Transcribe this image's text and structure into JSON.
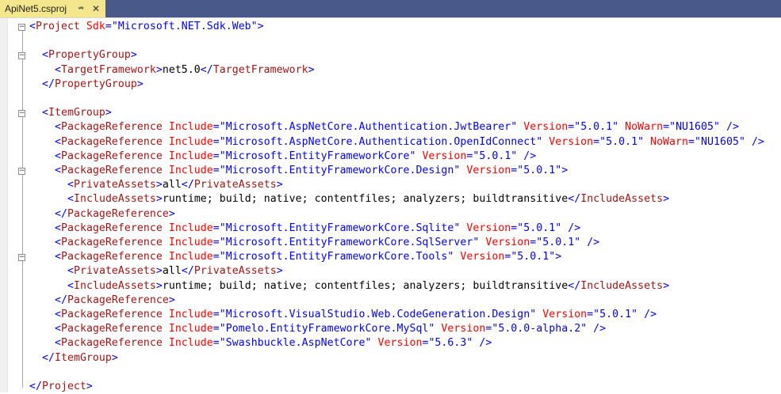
{
  "tab": {
    "title": "ApiNet5.csproj",
    "pin_icon": "pin-icon",
    "close_icon": "close-icon",
    "pin_glyph": "⇏",
    "close_glyph": "✕"
  },
  "colors": {
    "tabstrip_bg": "#495a8a",
    "tab_bg": "#f4e68c",
    "tag": "#a31515",
    "punctuation": "#0000ff",
    "attribute": "#ff0000",
    "value": "#0000ff",
    "text": "#000000"
  },
  "code_lines": [
    {
      "indent": 0,
      "tokens": [
        {
          "t": "punc",
          "v": "<"
        },
        {
          "t": "tag",
          "v": "Project"
        },
        {
          "t": "attr",
          "v": " Sdk"
        },
        {
          "t": "punc",
          "v": "="
        },
        {
          "t": "val",
          "v": "\"Microsoft.NET.Sdk.Web\""
        },
        {
          "t": "punc",
          "v": ">"
        }
      ]
    },
    {
      "indent": 0,
      "tokens": []
    },
    {
      "indent": 2,
      "tokens": [
        {
          "t": "punc",
          "v": "<"
        },
        {
          "t": "tag",
          "v": "PropertyGroup"
        },
        {
          "t": "punc",
          "v": ">"
        }
      ]
    },
    {
      "indent": 4,
      "tokens": [
        {
          "t": "punc",
          "v": "<"
        },
        {
          "t": "tag",
          "v": "TargetFramework"
        },
        {
          "t": "punc",
          "v": ">"
        },
        {
          "t": "txt",
          "v": "net5.0"
        },
        {
          "t": "punc",
          "v": "</"
        },
        {
          "t": "tag",
          "v": "TargetFramework"
        },
        {
          "t": "punc",
          "v": ">"
        }
      ]
    },
    {
      "indent": 2,
      "tokens": [
        {
          "t": "punc",
          "v": "</"
        },
        {
          "t": "tag",
          "v": "PropertyGroup"
        },
        {
          "t": "punc",
          "v": ">"
        }
      ]
    },
    {
      "indent": 0,
      "tokens": []
    },
    {
      "indent": 2,
      "tokens": [
        {
          "t": "punc",
          "v": "<"
        },
        {
          "t": "tag",
          "v": "ItemGroup"
        },
        {
          "t": "punc",
          "v": ">"
        }
      ]
    },
    {
      "indent": 4,
      "tokens": [
        {
          "t": "punc",
          "v": "<"
        },
        {
          "t": "tag",
          "v": "PackageReference"
        },
        {
          "t": "attr",
          "v": " Include"
        },
        {
          "t": "punc",
          "v": "="
        },
        {
          "t": "val",
          "v": "\"Microsoft.AspNetCore.Authentication.JwtBearer\""
        },
        {
          "t": "attr",
          "v": " Version"
        },
        {
          "t": "punc",
          "v": "="
        },
        {
          "t": "val",
          "v": "\"5.0.1\""
        },
        {
          "t": "attr",
          "v": " NoWarn"
        },
        {
          "t": "punc",
          "v": "="
        },
        {
          "t": "val",
          "v": "\"NU1605\""
        },
        {
          "t": "punc",
          "v": " />"
        }
      ]
    },
    {
      "indent": 4,
      "tokens": [
        {
          "t": "punc",
          "v": "<"
        },
        {
          "t": "tag",
          "v": "PackageReference"
        },
        {
          "t": "attr",
          "v": " Include"
        },
        {
          "t": "punc",
          "v": "="
        },
        {
          "t": "val",
          "v": "\"Microsoft.AspNetCore.Authentication.OpenIdConnect\""
        },
        {
          "t": "attr",
          "v": " Version"
        },
        {
          "t": "punc",
          "v": "="
        },
        {
          "t": "val",
          "v": "\"5.0.1\""
        },
        {
          "t": "attr",
          "v": " NoWarn"
        },
        {
          "t": "punc",
          "v": "="
        },
        {
          "t": "val",
          "v": "\"NU1605\""
        },
        {
          "t": "punc",
          "v": " />"
        }
      ]
    },
    {
      "indent": 4,
      "tokens": [
        {
          "t": "punc",
          "v": "<"
        },
        {
          "t": "tag",
          "v": "PackageReference"
        },
        {
          "t": "attr",
          "v": " Include"
        },
        {
          "t": "punc",
          "v": "="
        },
        {
          "t": "val",
          "v": "\"Microsoft.EntityFrameworkCore\""
        },
        {
          "t": "attr",
          "v": " Version"
        },
        {
          "t": "punc",
          "v": "="
        },
        {
          "t": "val",
          "v": "\"5.0.1\""
        },
        {
          "t": "punc",
          "v": " />"
        }
      ]
    },
    {
      "indent": 4,
      "tokens": [
        {
          "t": "punc",
          "v": "<"
        },
        {
          "t": "tag",
          "v": "PackageReference"
        },
        {
          "t": "attr",
          "v": " Include"
        },
        {
          "t": "punc",
          "v": "="
        },
        {
          "t": "val",
          "v": "\"Microsoft.EntityFrameworkCore.Design\""
        },
        {
          "t": "attr",
          "v": " Version"
        },
        {
          "t": "punc",
          "v": "="
        },
        {
          "t": "val",
          "v": "\"5.0.1\""
        },
        {
          "t": "punc",
          "v": ">"
        }
      ]
    },
    {
      "indent": 6,
      "tokens": [
        {
          "t": "punc",
          "v": "<"
        },
        {
          "t": "tag",
          "v": "PrivateAssets"
        },
        {
          "t": "punc",
          "v": ">"
        },
        {
          "t": "txt",
          "v": "all"
        },
        {
          "t": "punc",
          "v": "</"
        },
        {
          "t": "tag",
          "v": "PrivateAssets"
        },
        {
          "t": "punc",
          "v": ">"
        }
      ]
    },
    {
      "indent": 6,
      "tokens": [
        {
          "t": "punc",
          "v": "<"
        },
        {
          "t": "tag",
          "v": "IncludeAssets"
        },
        {
          "t": "punc",
          "v": ">"
        },
        {
          "t": "txt",
          "v": "runtime; build; native; contentfiles; analyzers; buildtransitive"
        },
        {
          "t": "punc",
          "v": "</"
        },
        {
          "t": "tag",
          "v": "IncludeAssets"
        },
        {
          "t": "punc",
          "v": ">"
        }
      ]
    },
    {
      "indent": 4,
      "tokens": [
        {
          "t": "punc",
          "v": "</"
        },
        {
          "t": "tag",
          "v": "PackageReference"
        },
        {
          "t": "punc",
          "v": ">"
        }
      ]
    },
    {
      "indent": 4,
      "tokens": [
        {
          "t": "punc",
          "v": "<"
        },
        {
          "t": "tag",
          "v": "PackageReference"
        },
        {
          "t": "attr",
          "v": " Include"
        },
        {
          "t": "punc",
          "v": "="
        },
        {
          "t": "val",
          "v": "\"Microsoft.EntityFrameworkCore.Sqlite\""
        },
        {
          "t": "attr",
          "v": " Version"
        },
        {
          "t": "punc",
          "v": "="
        },
        {
          "t": "val",
          "v": "\"5.0.1\""
        },
        {
          "t": "punc",
          "v": " />"
        }
      ]
    },
    {
      "indent": 4,
      "tokens": [
        {
          "t": "punc",
          "v": "<"
        },
        {
          "t": "tag",
          "v": "PackageReference"
        },
        {
          "t": "attr",
          "v": " Include"
        },
        {
          "t": "punc",
          "v": "="
        },
        {
          "t": "val",
          "v": "\"Microsoft.EntityFrameworkCore.SqlServer\""
        },
        {
          "t": "attr",
          "v": " Version"
        },
        {
          "t": "punc",
          "v": "="
        },
        {
          "t": "val",
          "v": "\"5.0.1\""
        },
        {
          "t": "punc",
          "v": " />"
        }
      ]
    },
    {
      "indent": 4,
      "tokens": [
        {
          "t": "punc",
          "v": "<"
        },
        {
          "t": "tag",
          "v": "PackageReference"
        },
        {
          "t": "attr",
          "v": " Include"
        },
        {
          "t": "punc",
          "v": "="
        },
        {
          "t": "val",
          "v": "\"Microsoft.EntityFrameworkCore.Tools\""
        },
        {
          "t": "attr",
          "v": " Version"
        },
        {
          "t": "punc",
          "v": "="
        },
        {
          "t": "val",
          "v": "\"5.0.1\""
        },
        {
          "t": "punc",
          "v": ">"
        }
      ]
    },
    {
      "indent": 6,
      "tokens": [
        {
          "t": "punc",
          "v": "<"
        },
        {
          "t": "tag",
          "v": "PrivateAssets"
        },
        {
          "t": "punc",
          "v": ">"
        },
        {
          "t": "txt",
          "v": "all"
        },
        {
          "t": "punc",
          "v": "</"
        },
        {
          "t": "tag",
          "v": "PrivateAssets"
        },
        {
          "t": "punc",
          "v": ">"
        }
      ]
    },
    {
      "indent": 6,
      "tokens": [
        {
          "t": "punc",
          "v": "<"
        },
        {
          "t": "tag",
          "v": "IncludeAssets"
        },
        {
          "t": "punc",
          "v": ">"
        },
        {
          "t": "txt",
          "v": "runtime; build; native; contentfiles; analyzers; buildtransitive"
        },
        {
          "t": "punc",
          "v": "</"
        },
        {
          "t": "tag",
          "v": "IncludeAssets"
        },
        {
          "t": "punc",
          "v": ">"
        }
      ]
    },
    {
      "indent": 4,
      "tokens": [
        {
          "t": "punc",
          "v": "</"
        },
        {
          "t": "tag",
          "v": "PackageReference"
        },
        {
          "t": "punc",
          "v": ">"
        }
      ]
    },
    {
      "indent": 4,
      "tokens": [
        {
          "t": "punc",
          "v": "<"
        },
        {
          "t": "tag",
          "v": "PackageReference"
        },
        {
          "t": "attr",
          "v": " Include"
        },
        {
          "t": "punc",
          "v": "="
        },
        {
          "t": "val",
          "v": "\"Microsoft.VisualStudio.Web.CodeGeneration.Design\""
        },
        {
          "t": "attr",
          "v": " Version"
        },
        {
          "t": "punc",
          "v": "="
        },
        {
          "t": "val",
          "v": "\"5.0.1\""
        },
        {
          "t": "punc",
          "v": " />"
        }
      ]
    },
    {
      "indent": 4,
      "tokens": [
        {
          "t": "punc",
          "v": "<"
        },
        {
          "t": "tag",
          "v": "PackageReference"
        },
        {
          "t": "attr",
          "v": " Include"
        },
        {
          "t": "punc",
          "v": "="
        },
        {
          "t": "val",
          "v": "\"Pomelo.EntityFrameworkCore.MySql\""
        },
        {
          "t": "attr",
          "v": " Version"
        },
        {
          "t": "punc",
          "v": "="
        },
        {
          "t": "val",
          "v": "\"5.0.0-alpha.2\""
        },
        {
          "t": "punc",
          "v": " />"
        }
      ]
    },
    {
      "indent": 4,
      "tokens": [
        {
          "t": "punc",
          "v": "<"
        },
        {
          "t": "tag",
          "v": "PackageReference"
        },
        {
          "t": "attr",
          "v": " Include"
        },
        {
          "t": "punc",
          "v": "="
        },
        {
          "t": "val",
          "v": "\"Swashbuckle.AspNetCore\""
        },
        {
          "t": "attr",
          "v": " Version"
        },
        {
          "t": "punc",
          "v": "="
        },
        {
          "t": "val",
          "v": "\"5.6.3\""
        },
        {
          "t": "punc",
          "v": " />"
        }
      ]
    },
    {
      "indent": 2,
      "tokens": [
        {
          "t": "punc",
          "v": "</"
        },
        {
          "t": "tag",
          "v": "ItemGroup"
        },
        {
          "t": "punc",
          "v": ">"
        }
      ]
    },
    {
      "indent": 0,
      "tokens": []
    },
    {
      "indent": 0,
      "tokens": [
        {
          "t": "punc",
          "v": "</"
        },
        {
          "t": "tag",
          "v": "Project"
        },
        {
          "t": "punc",
          "v": ">"
        }
      ]
    }
  ]
}
